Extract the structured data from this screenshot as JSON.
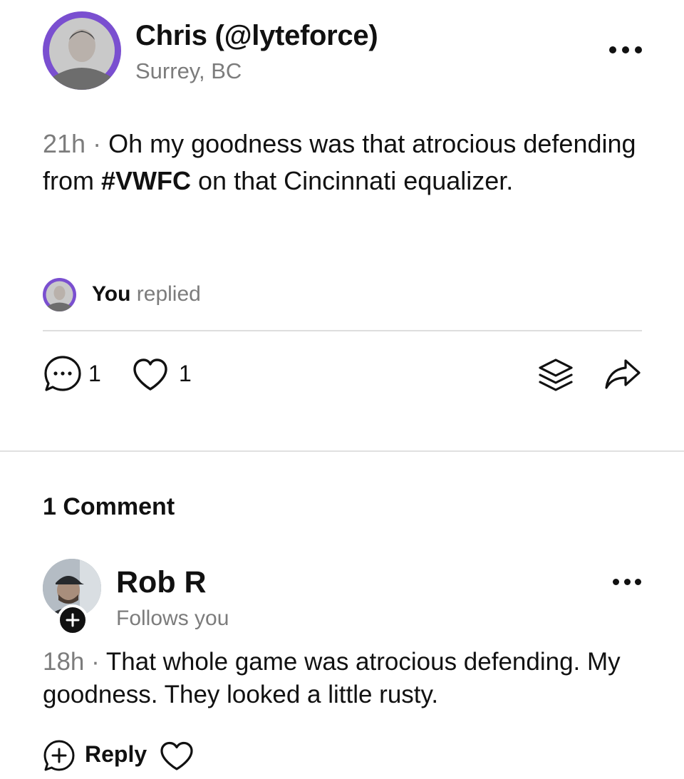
{
  "post": {
    "author": "Chris (@lyteforce)",
    "location": "Surrey, BC",
    "time": "21h",
    "separator": " · ",
    "text_before": "Oh my goodness was that atrocious defending from ",
    "hashtag": "#VWFC",
    "text_after": " on that Cincinnati equalizer.",
    "reply_status": {
      "you": "You",
      "replied": " replied"
    },
    "actions": {
      "comment_count": "1",
      "like_count": "1"
    }
  },
  "comments": {
    "heading": "1 Comment",
    "items": [
      {
        "author": "Rob R",
        "subtitle": "Follows you",
        "time": "18h",
        "separator": " · ",
        "text": "That whole game was atrocious defending. My goodness. They looked a little rusty.",
        "reply_label": "Reply"
      }
    ]
  },
  "colors": {
    "avatar_ring": "#7a4fd0",
    "muted_text": "#7c7c7c",
    "divider": "#dedede"
  },
  "icons": [
    "more-icon",
    "comment-icon",
    "heart-icon",
    "layers-icon",
    "share-icon",
    "plus-icon",
    "reply-icon"
  ]
}
